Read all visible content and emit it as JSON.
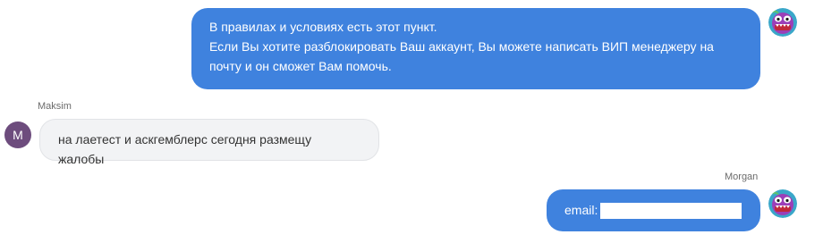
{
  "conversation": {
    "messages": [
      {
        "direction": "outgoing",
        "lines": [
          "В правилах и условиях есть этот пункт.",
          "Если Вы хотите разблокировать Ваш аккаунт, Вы можете написать ВИП менеджеру на",
          "почту и он сможет Вам помочь."
        ]
      },
      {
        "direction": "incoming",
        "sender": "Maksim",
        "avatar_letter": "M",
        "text": "на лаетест и аскгемблерс сегодня размещу жалобы"
      },
      {
        "direction": "outgoing",
        "sender": "Morgan",
        "text": "email:"
      }
    ]
  },
  "colors": {
    "outgoing_bubble": "#3f82de",
    "incoming_bubble": "#f2f3f5",
    "incoming_avatar": "#6d4c7d"
  },
  "icons": {
    "agent_avatar": "monster-avatar-icon"
  }
}
